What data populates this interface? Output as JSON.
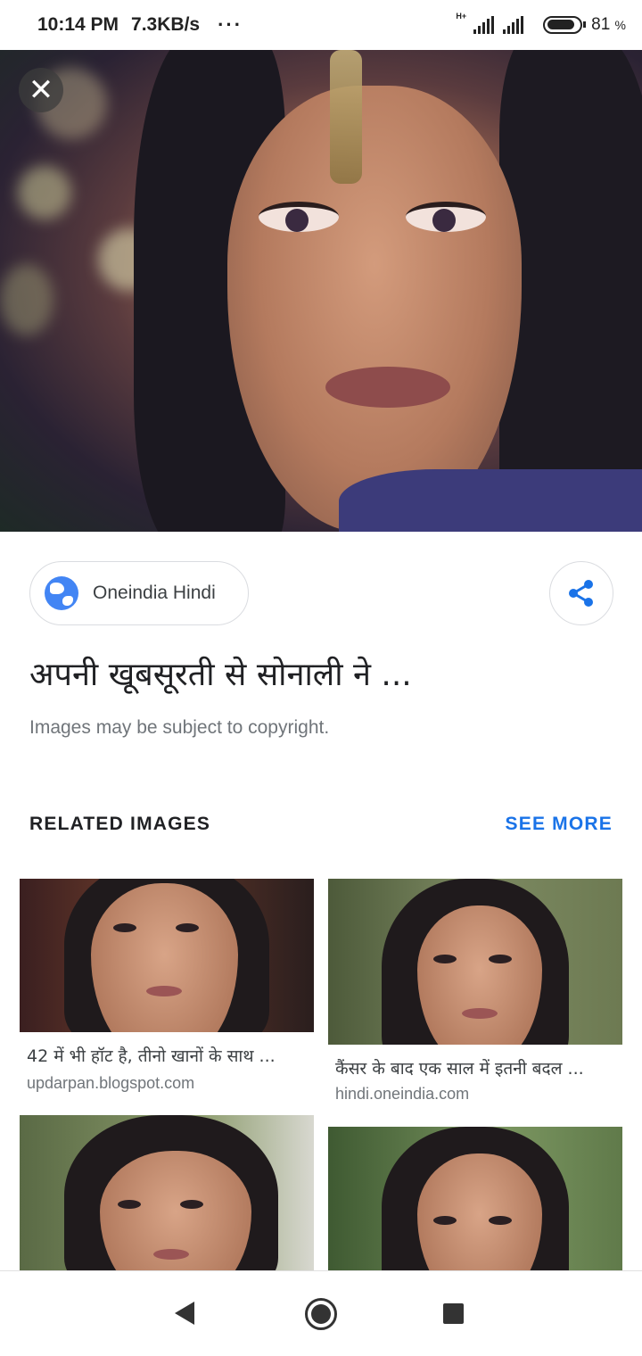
{
  "status_bar": {
    "time": "10:14 PM",
    "speed": "7.3KB/s",
    "more": "···",
    "network_type": "H+",
    "battery_percent": "81",
    "battery_unit": "%"
  },
  "viewer": {
    "close_icon": "close-icon"
  },
  "source": {
    "name": "Oneindia Hindi",
    "icon": "globe-icon",
    "share_icon": "share-icon"
  },
  "title": "अपनी खूबसूरती से सोनाली ने ...",
  "copyright": "Images may be subject to copyright.",
  "related": {
    "heading": "RELATED IMAGES",
    "see_more": "SEE MORE",
    "items": [
      {
        "caption": "42 में भी हॉट है, तीनो खानों के साथ ...",
        "domain": "updarpan.blogspot.com"
      },
      {
        "caption": "कैंसर के बाद एक साल में इतनी बदल ...",
        "domain": "hindi.oneindia.com"
      },
      {
        "caption": "",
        "domain": ""
      },
      {
        "caption": "",
        "domain": ""
      }
    ]
  },
  "nav": {
    "back_icon": "back-icon",
    "home_icon": "home-icon",
    "recents_icon": "recents-icon"
  },
  "colors": {
    "accent": "#1a73e8",
    "globe": "#4285f4",
    "text_secondary": "#70757a"
  }
}
